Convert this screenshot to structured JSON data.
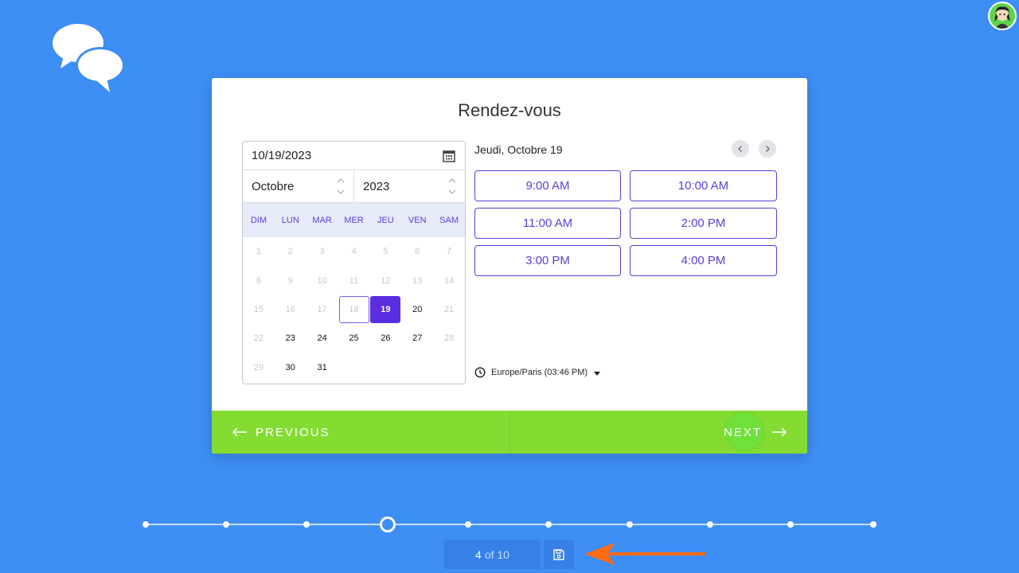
{
  "page": {
    "title": "Rendez-vous",
    "indicator_current": "4",
    "indicator_rest": "of 10",
    "progress": {
      "current": 4,
      "total": 10
    }
  },
  "calendar": {
    "date_value": "10/19/2023",
    "month": "Octobre",
    "year": "2023",
    "weekdays": [
      "DIM",
      "LUN",
      "MAR",
      "MER",
      "JEU",
      "VEN",
      "SAM"
    ],
    "weeks": [
      [
        "1",
        "2",
        "3",
        "4",
        "5",
        "6",
        "7"
      ],
      [
        "8",
        "9",
        "10",
        "11",
        "12",
        "13",
        "14"
      ],
      [
        "15",
        "16",
        "17",
        "18",
        "19",
        "20",
        "21"
      ],
      [
        "22",
        "23",
        "24",
        "25",
        "26",
        "27",
        "28"
      ],
      [
        "29",
        "30",
        "31",
        "",
        "",
        "",
        ""
      ]
    ],
    "selected_day": "19"
  },
  "schedule": {
    "day_label": "Jeudi, Octobre 19",
    "slots": [
      "9:00 AM",
      "10:00 AM",
      "11:00 AM",
      "2:00 PM",
      "3:00 PM",
      "4:00 PM"
    ],
    "timezone": "Europe/Paris (03:46 PM)"
  },
  "footer": {
    "previous_label": "PREVIOUS",
    "next_label": "NEXT"
  },
  "colors": {
    "background": "#3d8ef5",
    "accent": "#5a2de0",
    "footer": "#84dc33",
    "annotation": "#ff6a13"
  },
  "icons": {
    "logo": "chat-bubbles-icon",
    "calendar": "calendar-icon",
    "clock": "clock-icon",
    "save": "floppy-disk-icon"
  }
}
